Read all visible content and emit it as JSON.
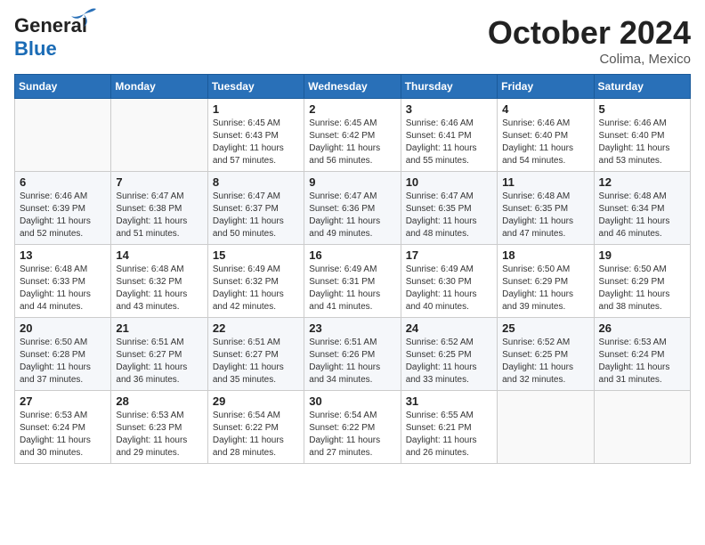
{
  "header": {
    "logo_general": "General",
    "logo_blue": "Blue",
    "month_title": "October 2024",
    "location": "Colima, Mexico"
  },
  "days_of_week": [
    "Sunday",
    "Monday",
    "Tuesday",
    "Wednesday",
    "Thursday",
    "Friday",
    "Saturday"
  ],
  "weeks": [
    [
      {
        "day": "",
        "info": ""
      },
      {
        "day": "",
        "info": ""
      },
      {
        "day": "1",
        "sunrise": "Sunrise: 6:45 AM",
        "sunset": "Sunset: 6:43 PM",
        "daylight": "Daylight: 11 hours and 57 minutes."
      },
      {
        "day": "2",
        "sunrise": "Sunrise: 6:45 AM",
        "sunset": "Sunset: 6:42 PM",
        "daylight": "Daylight: 11 hours and 56 minutes."
      },
      {
        "day": "3",
        "sunrise": "Sunrise: 6:46 AM",
        "sunset": "Sunset: 6:41 PM",
        "daylight": "Daylight: 11 hours and 55 minutes."
      },
      {
        "day": "4",
        "sunrise": "Sunrise: 6:46 AM",
        "sunset": "Sunset: 6:40 PM",
        "daylight": "Daylight: 11 hours and 54 minutes."
      },
      {
        "day": "5",
        "sunrise": "Sunrise: 6:46 AM",
        "sunset": "Sunset: 6:40 PM",
        "daylight": "Daylight: 11 hours and 53 minutes."
      }
    ],
    [
      {
        "day": "6",
        "sunrise": "Sunrise: 6:46 AM",
        "sunset": "Sunset: 6:39 PM",
        "daylight": "Daylight: 11 hours and 52 minutes."
      },
      {
        "day": "7",
        "sunrise": "Sunrise: 6:47 AM",
        "sunset": "Sunset: 6:38 PM",
        "daylight": "Daylight: 11 hours and 51 minutes."
      },
      {
        "day": "8",
        "sunrise": "Sunrise: 6:47 AM",
        "sunset": "Sunset: 6:37 PM",
        "daylight": "Daylight: 11 hours and 50 minutes."
      },
      {
        "day": "9",
        "sunrise": "Sunrise: 6:47 AM",
        "sunset": "Sunset: 6:36 PM",
        "daylight": "Daylight: 11 hours and 49 minutes."
      },
      {
        "day": "10",
        "sunrise": "Sunrise: 6:47 AM",
        "sunset": "Sunset: 6:35 PM",
        "daylight": "Daylight: 11 hours and 48 minutes."
      },
      {
        "day": "11",
        "sunrise": "Sunrise: 6:48 AM",
        "sunset": "Sunset: 6:35 PM",
        "daylight": "Daylight: 11 hours and 47 minutes."
      },
      {
        "day": "12",
        "sunrise": "Sunrise: 6:48 AM",
        "sunset": "Sunset: 6:34 PM",
        "daylight": "Daylight: 11 hours and 46 minutes."
      }
    ],
    [
      {
        "day": "13",
        "sunrise": "Sunrise: 6:48 AM",
        "sunset": "Sunset: 6:33 PM",
        "daylight": "Daylight: 11 hours and 44 minutes."
      },
      {
        "day": "14",
        "sunrise": "Sunrise: 6:48 AM",
        "sunset": "Sunset: 6:32 PM",
        "daylight": "Daylight: 11 hours and 43 minutes."
      },
      {
        "day": "15",
        "sunrise": "Sunrise: 6:49 AM",
        "sunset": "Sunset: 6:32 PM",
        "daylight": "Daylight: 11 hours and 42 minutes."
      },
      {
        "day": "16",
        "sunrise": "Sunrise: 6:49 AM",
        "sunset": "Sunset: 6:31 PM",
        "daylight": "Daylight: 11 hours and 41 minutes."
      },
      {
        "day": "17",
        "sunrise": "Sunrise: 6:49 AM",
        "sunset": "Sunset: 6:30 PM",
        "daylight": "Daylight: 11 hours and 40 minutes."
      },
      {
        "day": "18",
        "sunrise": "Sunrise: 6:50 AM",
        "sunset": "Sunset: 6:29 PM",
        "daylight": "Daylight: 11 hours and 39 minutes."
      },
      {
        "day": "19",
        "sunrise": "Sunrise: 6:50 AM",
        "sunset": "Sunset: 6:29 PM",
        "daylight": "Daylight: 11 hours and 38 minutes."
      }
    ],
    [
      {
        "day": "20",
        "sunrise": "Sunrise: 6:50 AM",
        "sunset": "Sunset: 6:28 PM",
        "daylight": "Daylight: 11 hours and 37 minutes."
      },
      {
        "day": "21",
        "sunrise": "Sunrise: 6:51 AM",
        "sunset": "Sunset: 6:27 PM",
        "daylight": "Daylight: 11 hours and 36 minutes."
      },
      {
        "day": "22",
        "sunrise": "Sunrise: 6:51 AM",
        "sunset": "Sunset: 6:27 PM",
        "daylight": "Daylight: 11 hours and 35 minutes."
      },
      {
        "day": "23",
        "sunrise": "Sunrise: 6:51 AM",
        "sunset": "Sunset: 6:26 PM",
        "daylight": "Daylight: 11 hours and 34 minutes."
      },
      {
        "day": "24",
        "sunrise": "Sunrise: 6:52 AM",
        "sunset": "Sunset: 6:25 PM",
        "daylight": "Daylight: 11 hours and 33 minutes."
      },
      {
        "day": "25",
        "sunrise": "Sunrise: 6:52 AM",
        "sunset": "Sunset: 6:25 PM",
        "daylight": "Daylight: 11 hours and 32 minutes."
      },
      {
        "day": "26",
        "sunrise": "Sunrise: 6:53 AM",
        "sunset": "Sunset: 6:24 PM",
        "daylight": "Daylight: 11 hours and 31 minutes."
      }
    ],
    [
      {
        "day": "27",
        "sunrise": "Sunrise: 6:53 AM",
        "sunset": "Sunset: 6:24 PM",
        "daylight": "Daylight: 11 hours and 30 minutes."
      },
      {
        "day": "28",
        "sunrise": "Sunrise: 6:53 AM",
        "sunset": "Sunset: 6:23 PM",
        "daylight": "Daylight: 11 hours and 29 minutes."
      },
      {
        "day": "29",
        "sunrise": "Sunrise: 6:54 AM",
        "sunset": "Sunset: 6:22 PM",
        "daylight": "Daylight: 11 hours and 28 minutes."
      },
      {
        "day": "30",
        "sunrise": "Sunrise: 6:54 AM",
        "sunset": "Sunset: 6:22 PM",
        "daylight": "Daylight: 11 hours and 27 minutes."
      },
      {
        "day": "31",
        "sunrise": "Sunrise: 6:55 AM",
        "sunset": "Sunset: 6:21 PM",
        "daylight": "Daylight: 11 hours and 26 minutes."
      },
      {
        "day": "",
        "info": ""
      },
      {
        "day": "",
        "info": ""
      }
    ]
  ]
}
